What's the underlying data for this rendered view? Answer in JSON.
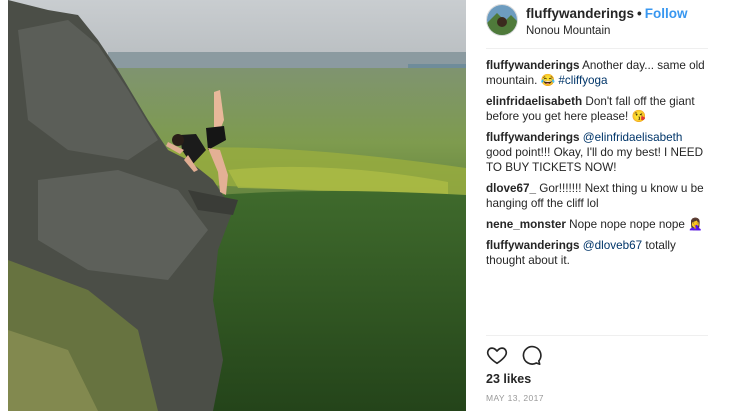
{
  "header": {
    "username": "fluffywanderings",
    "separator": "•",
    "follow_label": "Follow",
    "location": "Nonou Mountain"
  },
  "comments": [
    {
      "user": "fluffywanderings",
      "text_before": " Another day... same old mountain. ",
      "emoji": "😂",
      "hashtag": "#cliffyoga",
      "text_after": ""
    },
    {
      "user": "elinfridaelisabeth",
      "text": " Don't fall off the giant before you get here please! ",
      "emoji": "😘"
    },
    {
      "user": "fluffywanderings",
      "mention": "@elinfridaelisabeth",
      "text": " good point!!! Okay, I'll do my best! I NEED TO BUY TICKETS NOW!"
    },
    {
      "user": "dlove67_",
      "text": " Gor!!!!!!! Next thing u know u be hanging off the cliff lol"
    },
    {
      "user": "nene_monster",
      "text": " Nope nope nope nope ",
      "emoji": "🤦‍♀️"
    },
    {
      "user": "fluffywanderings",
      "mention": "@dloveb67",
      "text": " totally thought about it."
    }
  ],
  "actions": {
    "like_icon": "heart-icon",
    "comment_icon": "comment-icon"
  },
  "likes": "23 likes",
  "date": "MAY 13, 2017"
}
